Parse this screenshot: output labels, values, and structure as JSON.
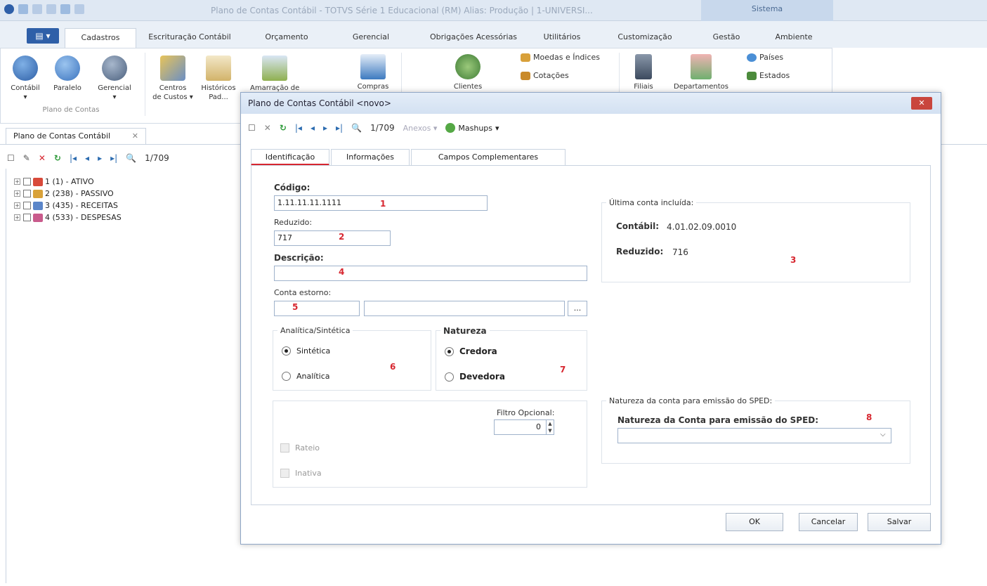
{
  "window": {
    "title": "Plano de Contas Contábil - TOTVS Série 1 Educacional (RM) Alias: Produção | 1-UNIVERSI...",
    "sistema_label": "Sistema"
  },
  "ribbon": {
    "file_label": "▤ ▾",
    "tabs": [
      "Cadastros",
      "Escrituração Contábil",
      "Orçamento",
      "Gerencial",
      "Obrigações Acessórias",
      "Utilitários",
      "Customização",
      "Gestão",
      "Ambiente"
    ],
    "plano_group": {
      "buttons": [
        "Contábil",
        "Paralelo",
        "Gerencial"
      ],
      "label": "Plano de Contas"
    },
    "centros": {
      "line1": "Centros",
      "line2": "de Custos ▾"
    },
    "historicos": {
      "line1": "Históricos",
      "line2": "Pad..."
    },
    "small_items": [
      "Moedas e Índices",
      "Cotações",
      "Países",
      "Estados"
    ],
    "partial_labels": [
      "Amarração de...",
      "Compras",
      "Clientes",
      "Filiais",
      "Departamentos"
    ]
  },
  "doc_tab": {
    "label": "Plano de Contas Contábil",
    "close": "✕"
  },
  "left_toolbar": {
    "counter": "1/709"
  },
  "tree": [
    {
      "label": "1 (1) - ATIVO",
      "color": "#d84a3a"
    },
    {
      "label": "2 (238) - PASSIVO",
      "color": "#d9a23a"
    },
    {
      "label": "3 (435) - RECEITAS",
      "color": "#5b86c9"
    },
    {
      "label": "4 (533) - DESPESAS",
      "color": "#c95b8c"
    }
  ],
  "dialog": {
    "title": "Plano de Contas Contábil <novo>",
    "close": "✕",
    "counter": "1/709",
    "anexos": "Anexos",
    "mashups": "Mashups",
    "tabs": [
      "Identificação",
      "Informações",
      "Campos Complementares"
    ],
    "codigo": {
      "label": "Código:",
      "value": "1.11.11.11.1111"
    },
    "reduzido": {
      "label": "Reduzido:",
      "value": "717"
    },
    "descricao": {
      "label": "Descrição:",
      "value": ""
    },
    "conta_estorno": {
      "label": "Conta estorno:",
      "btn": "..."
    },
    "ultima": {
      "caption": "Última conta incluída:",
      "contabil_label": "Contábil:",
      "contabil_value": "4.01.02.09.0010",
      "reduzido_label": "Reduzido:",
      "reduzido_value": "716"
    },
    "analitica": {
      "caption": "Analítica/Sintética",
      "opt1": "Sintética",
      "opt2": "Analítica"
    },
    "natureza": {
      "caption": "Natureza",
      "opt1": "Credora",
      "opt2": "Devedora"
    },
    "filtro": {
      "label": "Filtro Opcional:",
      "value": "0"
    },
    "rateio": "Rateio",
    "inativa": "Inativa",
    "sped": {
      "caption": "Natureza da conta para emissão do SPED:",
      "label": "Natureza da Conta para emissão do SPED:",
      "value": ""
    },
    "buttons": {
      "ok": "OK",
      "cancel": "Cancelar",
      "save": "Salvar"
    }
  },
  "annotations": [
    "1",
    "2",
    "3",
    "4",
    "5",
    "6",
    "7",
    "8"
  ]
}
